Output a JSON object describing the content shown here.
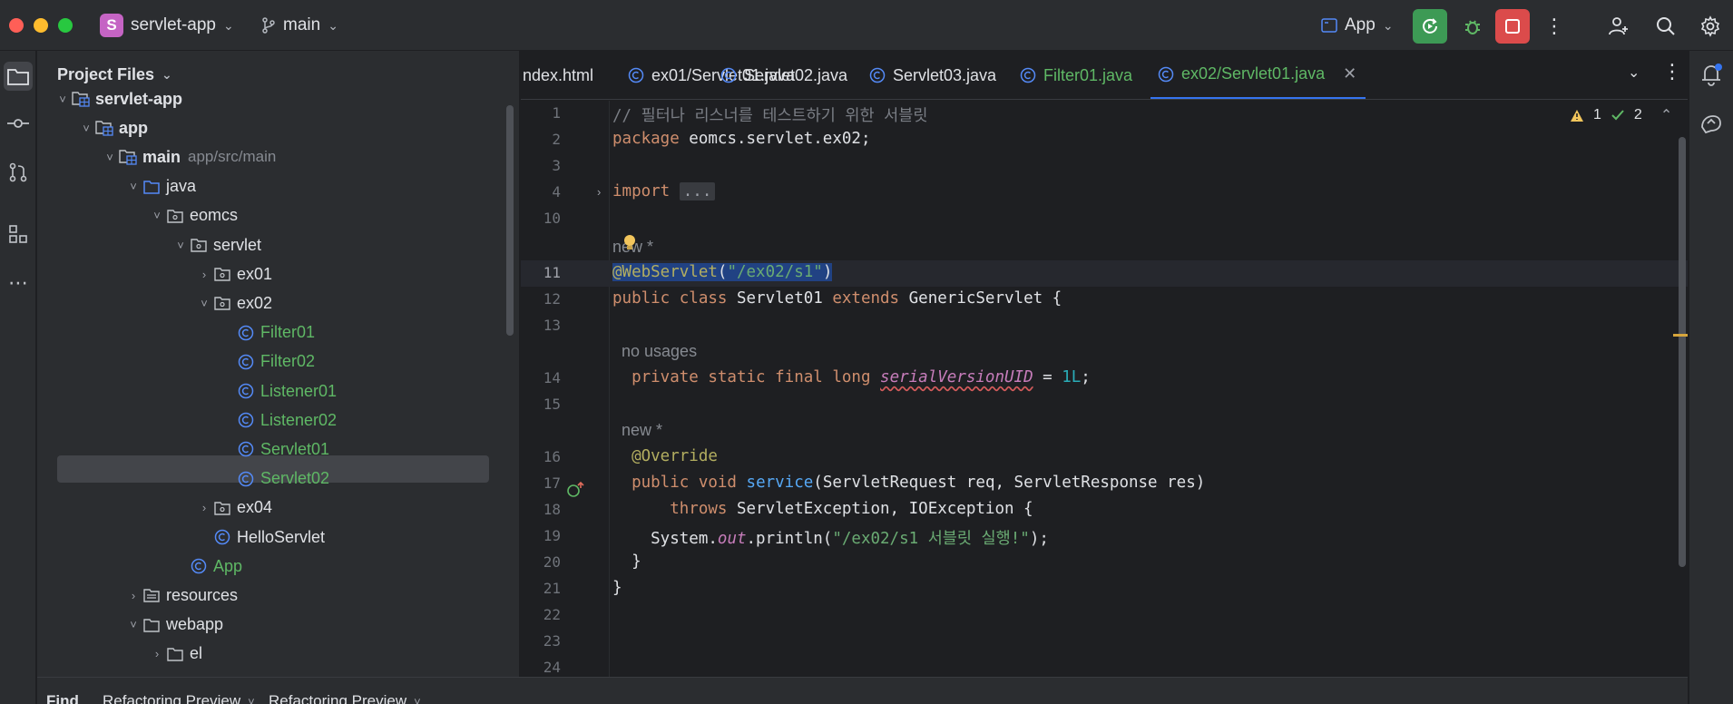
{
  "titlebar": {
    "project_initial": "S",
    "project_name": "servlet-app",
    "branch": "main",
    "run_config": "App"
  },
  "project_panel": {
    "title": "Project Files",
    "tree": [
      {
        "label": "servlet-app",
        "hint": "",
        "depth": 0,
        "arrow": "open",
        "icon": "module-folder-icon",
        "bold": true,
        "green": false
      },
      {
        "label": "app",
        "hint": "",
        "depth": 1,
        "arrow": "open",
        "icon": "module-folder-icon",
        "bold": true,
        "green": false
      },
      {
        "label": "main",
        "hint": "app/src/main",
        "depth": 2,
        "arrow": "open",
        "icon": "module-folder-icon",
        "bold": true,
        "green": false
      },
      {
        "label": "java",
        "hint": "",
        "depth": 3,
        "arrow": "open",
        "icon": "source-folder-icon",
        "bold": false,
        "green": false
      },
      {
        "label": "eomcs",
        "hint": "",
        "depth": 4,
        "arrow": "open",
        "icon": "package-icon",
        "bold": false,
        "green": false
      },
      {
        "label": "servlet",
        "hint": "",
        "depth": 5,
        "arrow": "open",
        "icon": "package-icon",
        "bold": false,
        "green": false
      },
      {
        "label": "ex01",
        "hint": "",
        "depth": 6,
        "arrow": "closed",
        "icon": "package-icon",
        "bold": false,
        "green": false
      },
      {
        "label": "ex02",
        "hint": "",
        "depth": 6,
        "arrow": "open",
        "icon": "package-icon",
        "bold": false,
        "green": false
      },
      {
        "label": "Filter01",
        "hint": "",
        "depth": 7,
        "arrow": "none",
        "icon": "class-icon",
        "bold": false,
        "green": true
      },
      {
        "label": "Filter02",
        "hint": "",
        "depth": 7,
        "arrow": "none",
        "icon": "class-icon",
        "bold": false,
        "green": true
      },
      {
        "label": "Listener01",
        "hint": "",
        "depth": 7,
        "arrow": "none",
        "icon": "class-icon",
        "bold": false,
        "green": true
      },
      {
        "label": "Listener02",
        "hint": "",
        "depth": 7,
        "arrow": "none",
        "icon": "class-icon",
        "bold": false,
        "green": true
      },
      {
        "label": "Servlet01",
        "hint": "",
        "depth": 7,
        "arrow": "none",
        "icon": "class-icon",
        "bold": false,
        "green": true,
        "selected": true
      },
      {
        "label": "Servlet02",
        "hint": "",
        "depth": 7,
        "arrow": "none",
        "icon": "class-icon",
        "bold": false,
        "green": true
      },
      {
        "label": "ex04",
        "hint": "",
        "depth": 6,
        "arrow": "closed",
        "icon": "package-icon",
        "bold": false,
        "green": false
      },
      {
        "label": "HelloServlet",
        "hint": "",
        "depth": 6,
        "arrow": "none",
        "icon": "class-icon",
        "bold": false,
        "green": false
      },
      {
        "label": "App",
        "hint": "",
        "depth": 5,
        "arrow": "none",
        "icon": "class-icon",
        "bold": false,
        "green": true
      },
      {
        "label": "resources",
        "hint": "",
        "depth": 3,
        "arrow": "closed",
        "icon": "resources-folder-icon",
        "bold": false,
        "green": false
      },
      {
        "label": "webapp",
        "hint": "",
        "depth": 3,
        "arrow": "open",
        "icon": "folder-icon",
        "bold": false,
        "green": false
      },
      {
        "label": "el",
        "hint": "",
        "depth": 4,
        "arrow": "closed",
        "icon": "folder-icon",
        "bold": false,
        "green": false
      }
    ]
  },
  "tabs": [
    {
      "label": "ndex.html",
      "icon": "",
      "green": false,
      "active": false
    },
    {
      "label": "ex01/Servlet01.java",
      "icon": "class-icon",
      "green": false,
      "active": false
    },
    {
      "label": "Servlet02.java",
      "icon": "class-icon",
      "green": false,
      "active": false
    },
    {
      "label": "Servlet03.java",
      "icon": "class-icon",
      "green": false,
      "active": false
    },
    {
      "label": "Filter01.java",
      "icon": "class-icon",
      "green": true,
      "active": false
    },
    {
      "label": "ex02/Servlet01.java",
      "icon": "class-icon",
      "green": true,
      "active": true
    }
  ],
  "editor": {
    "warnings": "1",
    "checks": "2",
    "lines": [
      {
        "ln": "1",
        "segs": [
          [
            "c-comment",
            "// 필터나 리스너를 테스트하기 위한 서블릿"
          ]
        ]
      },
      {
        "ln": "2",
        "segs": [
          [
            "c-kw",
            "package"
          ],
          [
            "",
            " eomcs.servlet.ex02;"
          ]
        ]
      },
      {
        "ln": "3",
        "segs": []
      },
      {
        "ln": "4",
        "segs": [
          [
            "c-kw",
            "import"
          ],
          [
            "",
            " "
          ],
          [
            "c-fold",
            "..."
          ]
        ]
      },
      {
        "ln": "10",
        "segs": []
      },
      {
        "ln": "",
        "inlay": "new *"
      },
      {
        "ln": "11",
        "caret": true,
        "segs": [
          [
            "selection c-ann",
            "@WebServlet"
          ],
          [
            "selection",
            "("
          ],
          [
            "selection c-str",
            "\"/ex02/s1\""
          ],
          [
            "selection",
            ")"
          ]
        ]
      },
      {
        "ln": "12",
        "segs": [
          [
            "c-kw",
            "public class"
          ],
          [
            "",
            " Servlet01 "
          ],
          [
            "c-kw",
            "extends"
          ],
          [
            "",
            " GenericServlet {"
          ]
        ]
      },
      {
        "ln": "13",
        "segs": []
      },
      {
        "ln": "",
        "inlay": "  no usages"
      },
      {
        "ln": "14",
        "segs": [
          [
            "",
            "  "
          ],
          [
            "c-kw",
            "private static final long"
          ],
          [
            "",
            " "
          ],
          [
            "c-field squiggle-red",
            "serialVersionUID"
          ],
          [
            "",
            " = "
          ],
          [
            "c-num",
            "1L"
          ],
          [
            "",
            ";"
          ]
        ]
      },
      {
        "ln": "15",
        "segs": []
      },
      {
        "ln": "",
        "inlay": "  new *"
      },
      {
        "ln": "16",
        "segs": [
          [
            "",
            "  "
          ],
          [
            "c-ann",
            "@Override"
          ]
        ]
      },
      {
        "ln": "17",
        "segs": [
          [
            "",
            "  "
          ],
          [
            "c-kw",
            "public void"
          ],
          [
            "",
            " "
          ],
          [
            "c-fn",
            "service"
          ],
          [
            "",
            "(ServletRequest req, ServletResponse res)"
          ]
        ]
      },
      {
        "ln": "18",
        "segs": [
          [
            "",
            "      "
          ],
          [
            "c-kw",
            "throws"
          ],
          [
            "",
            " ServletException, IOException {"
          ]
        ]
      },
      {
        "ln": "19",
        "segs": [
          [
            "",
            "    System."
          ],
          [
            "c-static",
            "out"
          ],
          [
            "",
            ".println("
          ],
          [
            "c-str",
            "\"/ex02/s1 서블릿 실행!\""
          ],
          [
            "",
            ");"
          ]
        ]
      },
      {
        "ln": "20",
        "segs": [
          [
            "",
            "  }"
          ]
        ]
      },
      {
        "ln": "21",
        "segs": [
          [
            "",
            "}"
          ]
        ]
      },
      {
        "ln": "22",
        "segs": []
      },
      {
        "ln": "23",
        "segs": []
      },
      {
        "ln": "24",
        "segs": []
      }
    ]
  },
  "bottom_tabs": [
    "Find",
    "Refactoring Preview",
    "Refactoring Preview"
  ],
  "colors": {
    "accent": "#3574f0",
    "run_green": "#3d9a55",
    "stop_red": "#db4b4b",
    "class_green": "#5fb865"
  }
}
